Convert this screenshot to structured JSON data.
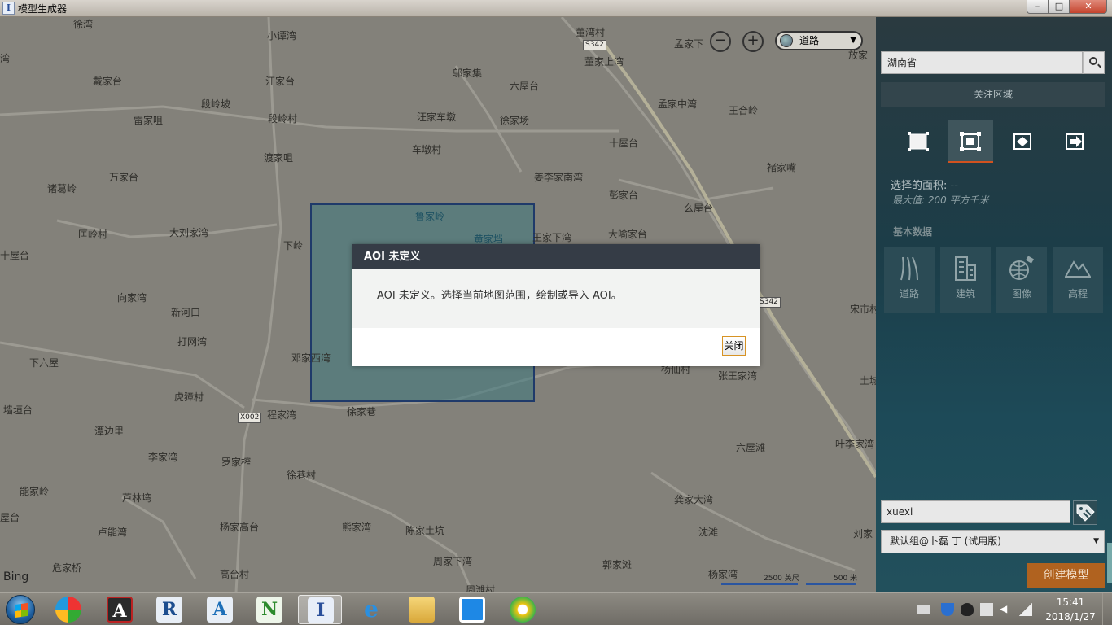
{
  "window": {
    "title": "模型生成器",
    "controls": {
      "minimize": "–",
      "maximize": "□",
      "close": "✕"
    }
  },
  "map": {
    "zoom_out": "−",
    "zoom_in": "+",
    "style_selector": "道路",
    "attribution": "Bing",
    "scale_labels": [
      "2500 英尺",
      "500 米"
    ],
    "road_shields": [
      "S342",
      "S342",
      "X002"
    ],
    "places": [
      "徐湾",
      "小谭湾",
      "董湾村",
      "孟家下",
      "放家",
      "湾",
      "戴家台",
      "汪家台",
      "邬家集",
      "六屋台",
      "董家上湾",
      "段岭坡",
      "段岭村",
      "孟家中湾",
      "王合岭",
      "雷家咀",
      "汪家车墩",
      "徐家场",
      "渡家咀",
      "车墩村",
      "十屋台",
      "褚家嘴",
      "万家台",
      "姜李家南湾",
      "诸葛岭",
      "彭家台",
      "么屋台",
      "鲁家岭",
      "匡岭村",
      "大刘家湾",
      "黄家垱",
      "王家下湾",
      "大喻家台",
      "十屋台",
      "下岭",
      "向家湾",
      "新河口",
      "打网湾",
      "宋市村",
      "下六屋",
      "邓家西湾",
      "杨仙村",
      "张王家湾",
      "土城",
      "虎獐村",
      "墙垣台",
      "程家湾",
      "徐家巷",
      "潭边里",
      "六屋滩",
      "叶李家湾",
      "李家湾",
      "罗家榨",
      "徐巷村",
      "能家岭",
      "芦林塆",
      "龚家大湾",
      "屋台",
      "卢能湾",
      "杨家高台",
      "熊家湾",
      "陈家土坑",
      "沈滩",
      "刘家",
      "危家桥",
      "周家下湾",
      "郭家滩",
      "高台村",
      "杨家湾",
      "周滩村"
    ]
  },
  "dialog": {
    "title": "AOI 未定义",
    "message": "AOI 未定义。选择当前地图范围，绘制或导入 AOI。",
    "close_label": "关闭"
  },
  "panel": {
    "search_value": "湖南省",
    "focus_area_header": "关注区域",
    "selected_area": "选择的面积: --",
    "max_area": "最大值: 200 平方千米",
    "basic_data_title": "基本数据",
    "data_tiles": [
      "道路",
      "建筑",
      "图像",
      "高程"
    ],
    "user": "xuexi",
    "group": "默认组@卜磊 丁 (试用版)",
    "create_model": "创建模型"
  },
  "taskbar": {
    "time": "15:41",
    "date": "2018/1/27"
  },
  "colors": {
    "accent": "#d2521f",
    "create_button": "#b0621f",
    "dialog_header": "#353c46",
    "panel_bg": "#1d4a58"
  }
}
